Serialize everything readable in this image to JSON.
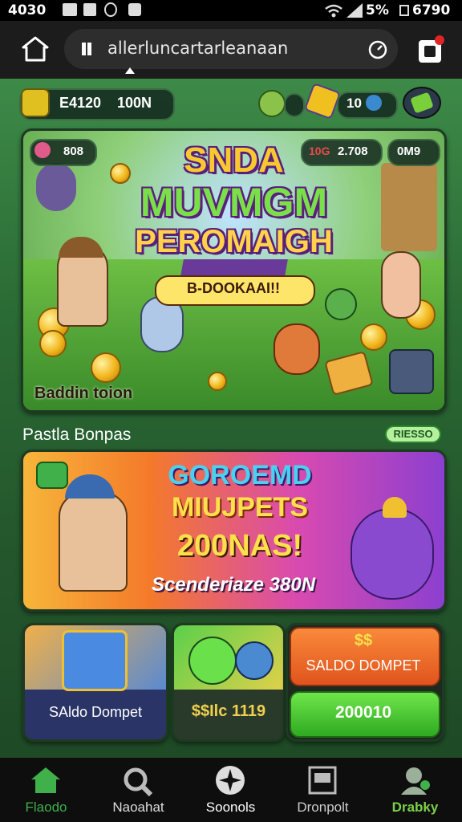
{
  "status_bar": {
    "time": "4030",
    "battery": "5%",
    "clock": "6790"
  },
  "browser": {
    "url": "allerluncartarleanaan"
  },
  "top_bar": {
    "coins_label": "E4120",
    "gems_label": "100N",
    "score_label": "10"
  },
  "hero": {
    "badge_left": "808",
    "badge_mid": "10G",
    "badge_mid_value": "2.708",
    "badge_right": "0M9",
    "title_line1": "SNDA",
    "title_line2": "MUVMGM",
    "title_line3": "PEROMAIGH",
    "subtitle": "B-DOOKAAI!!",
    "caption": "Baddin toion"
  },
  "section": {
    "title": "Pastla Bonpas",
    "tag": "RIESSO"
  },
  "promo": {
    "line1": "GOROEMD",
    "line2": "MIUJPETS",
    "line3": "200NAS!",
    "line4": "Scenderiaze 380N"
  },
  "tiles": {
    "tile1_label": "SAldo Dompet",
    "tile2_label": "$$Ilc 1119",
    "tile3_top_symbol": "$$",
    "tile3_top_label": "SALDO DOMPET",
    "tile3_button_label": "200010"
  },
  "nav": [
    {
      "label": "Flaodo",
      "icon": "home-icon"
    },
    {
      "label": "Naoahat",
      "icon": "search-icon"
    },
    {
      "label": "Soonols",
      "icon": "compass-icon"
    },
    {
      "label": "Dronpolt",
      "icon": "wallet-icon"
    },
    {
      "label": "Drabky",
      "icon": "profile-icon"
    }
  ],
  "colors": {
    "accent_green": "#6ee64a",
    "nav_active": "#3fb04a"
  }
}
